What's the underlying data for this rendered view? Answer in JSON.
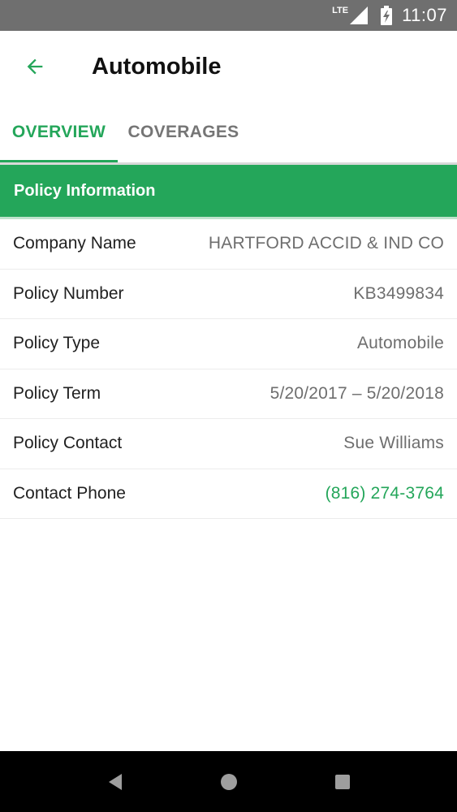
{
  "status_bar": {
    "network": "LTE",
    "time": "11:07"
  },
  "app_bar": {
    "title": "Automobile"
  },
  "tabs": [
    {
      "label": "OVERVIEW",
      "selected": true
    },
    {
      "label": "COVERAGES",
      "selected": false
    }
  ],
  "section": {
    "title": "Policy Information"
  },
  "policy_info": [
    {
      "label": "Company Name",
      "value": "HARTFORD ACCID & IND CO"
    },
    {
      "label": "Policy Number",
      "value": "KB3499834"
    },
    {
      "label": "Policy Type",
      "value": "Automobile"
    },
    {
      "label": "Policy Term",
      "value": "5/20/2017 – 5/20/2018"
    },
    {
      "label": "Policy Contact",
      "value": "Sue Williams"
    },
    {
      "label": "Contact Phone",
      "value": "(816) 274-3764"
    }
  ],
  "colors": {
    "accent": "#24a65a",
    "status_bar": "#6f6f6f",
    "nav_bar": "#000000"
  },
  "icons": {
    "back": "arrow-left-icon",
    "signal": "signal-icon",
    "battery": "battery-charging-icon",
    "nav_back": "triangle-back-icon",
    "nav_home": "circle-home-icon",
    "nav_recents": "square-recents-icon"
  }
}
